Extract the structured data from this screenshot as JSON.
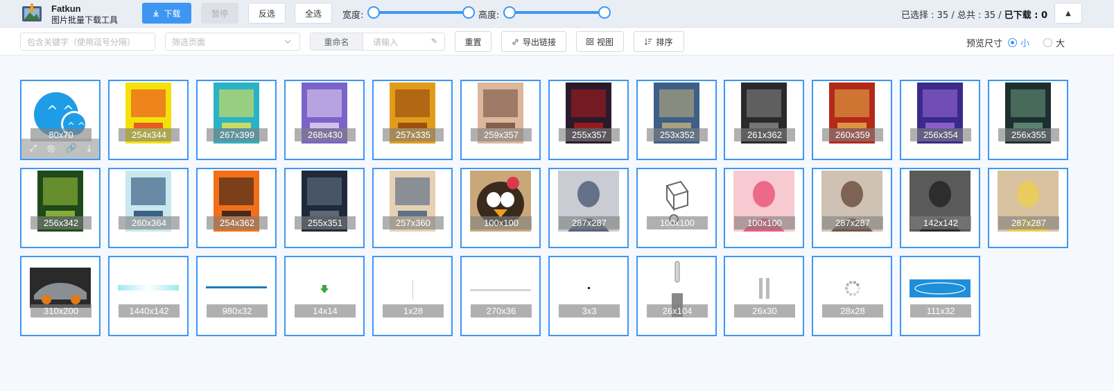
{
  "app": {
    "name": "Fatkun",
    "subtitle": "图片批量下载工具"
  },
  "toolbar": {
    "download_label": "下载",
    "pause_label": "暂停",
    "invert_label": "反选",
    "select_all_label": "全选",
    "width_label": "宽度:",
    "height_label": "高度:",
    "status_selected": "已选择 : 35",
    "status_total": " / 总共 : 35 / ",
    "status_downloaded": "已下载 : 0"
  },
  "filters": {
    "keyword_placeholder": "包含关键字（使用逗号分隔）",
    "page_placeholder": "筛选页面",
    "rename_label": "重命名",
    "rename_placeholder": "请输入",
    "reset_label": "重置",
    "export_label": "导出链接",
    "view_label": "视图",
    "sort_label": "排序",
    "preview_label": "预览尺寸",
    "size_small": "小",
    "size_large": "大"
  },
  "icons": {
    "download": "download-icon",
    "link": "link-icon",
    "grid": "grid-icon",
    "sort": "sort-icon",
    "expand": "expand-icon",
    "weibo": "weibo-icon",
    "edit": "pen-icon",
    "collapse": "chevron-up-icon"
  },
  "colors": {
    "accent": "#3d96f1",
    "tile_border": "#3d96f1"
  },
  "images": [
    {
      "size": "80x70",
      "thumb": "qq-icon"
    },
    {
      "size": "254x344",
      "thumb": "poster-yellow"
    },
    {
      "size": "267x399",
      "thumb": "poster-teal"
    },
    {
      "size": "268x430",
      "thumb": "poster-purple"
    },
    {
      "size": "257x335",
      "thumb": "poster-orange"
    },
    {
      "size": "259x357",
      "thumb": "poster-couple"
    },
    {
      "size": "255x357",
      "thumb": "poster-dark"
    },
    {
      "size": "253x352",
      "thumb": "poster-pilot"
    },
    {
      "size": "261x362",
      "thumb": "poster-bw"
    },
    {
      "size": "260x359",
      "thumb": "poster-red"
    },
    {
      "size": "256x354",
      "thumb": "poster-violet"
    },
    {
      "size": "256x355",
      "thumb": "poster-green-dark"
    },
    {
      "size": "256x342",
      "thumb": "poster-tree"
    },
    {
      "size": "260x364",
      "thumb": "poster-shadow-moon"
    },
    {
      "size": "254x362",
      "thumb": "poster-warning"
    },
    {
      "size": "255x351",
      "thumb": "poster-suits"
    },
    {
      "size": "257x360",
      "thumb": "poster-family"
    },
    {
      "size": "100x100",
      "thumb": "penguin-avatar"
    },
    {
      "size": "287x287",
      "thumb": "portrait-man"
    },
    {
      "size": "100x100",
      "thumb": "sketch-cube"
    },
    {
      "size": "100x100",
      "thumb": "pink-heart"
    },
    {
      "size": "287x287",
      "thumb": "portrait-woman"
    },
    {
      "size": "142x142",
      "thumb": "portrait-bw"
    },
    {
      "size": "287x287",
      "thumb": "portrait-flower"
    },
    {
      "size": "310x200",
      "thumb": "car-photo"
    },
    {
      "size": "1440x142",
      "thumb": "banner-cyan"
    },
    {
      "size": "980x32",
      "thumb": "line-blue"
    },
    {
      "size": "14x14",
      "thumb": "arrow-green"
    },
    {
      "size": "1x28",
      "thumb": "line-thin"
    },
    {
      "size": "270x36",
      "thumb": "bar-gray"
    },
    {
      "size": "3x3",
      "thumb": "dot"
    },
    {
      "size": "26x104",
      "thumb": "scroll-bar"
    },
    {
      "size": "26x30",
      "thumb": "double-bars"
    },
    {
      "size": "28x28",
      "thumb": "spinner"
    },
    {
      "size": "111x32",
      "thumb": "blue-button"
    }
  ]
}
